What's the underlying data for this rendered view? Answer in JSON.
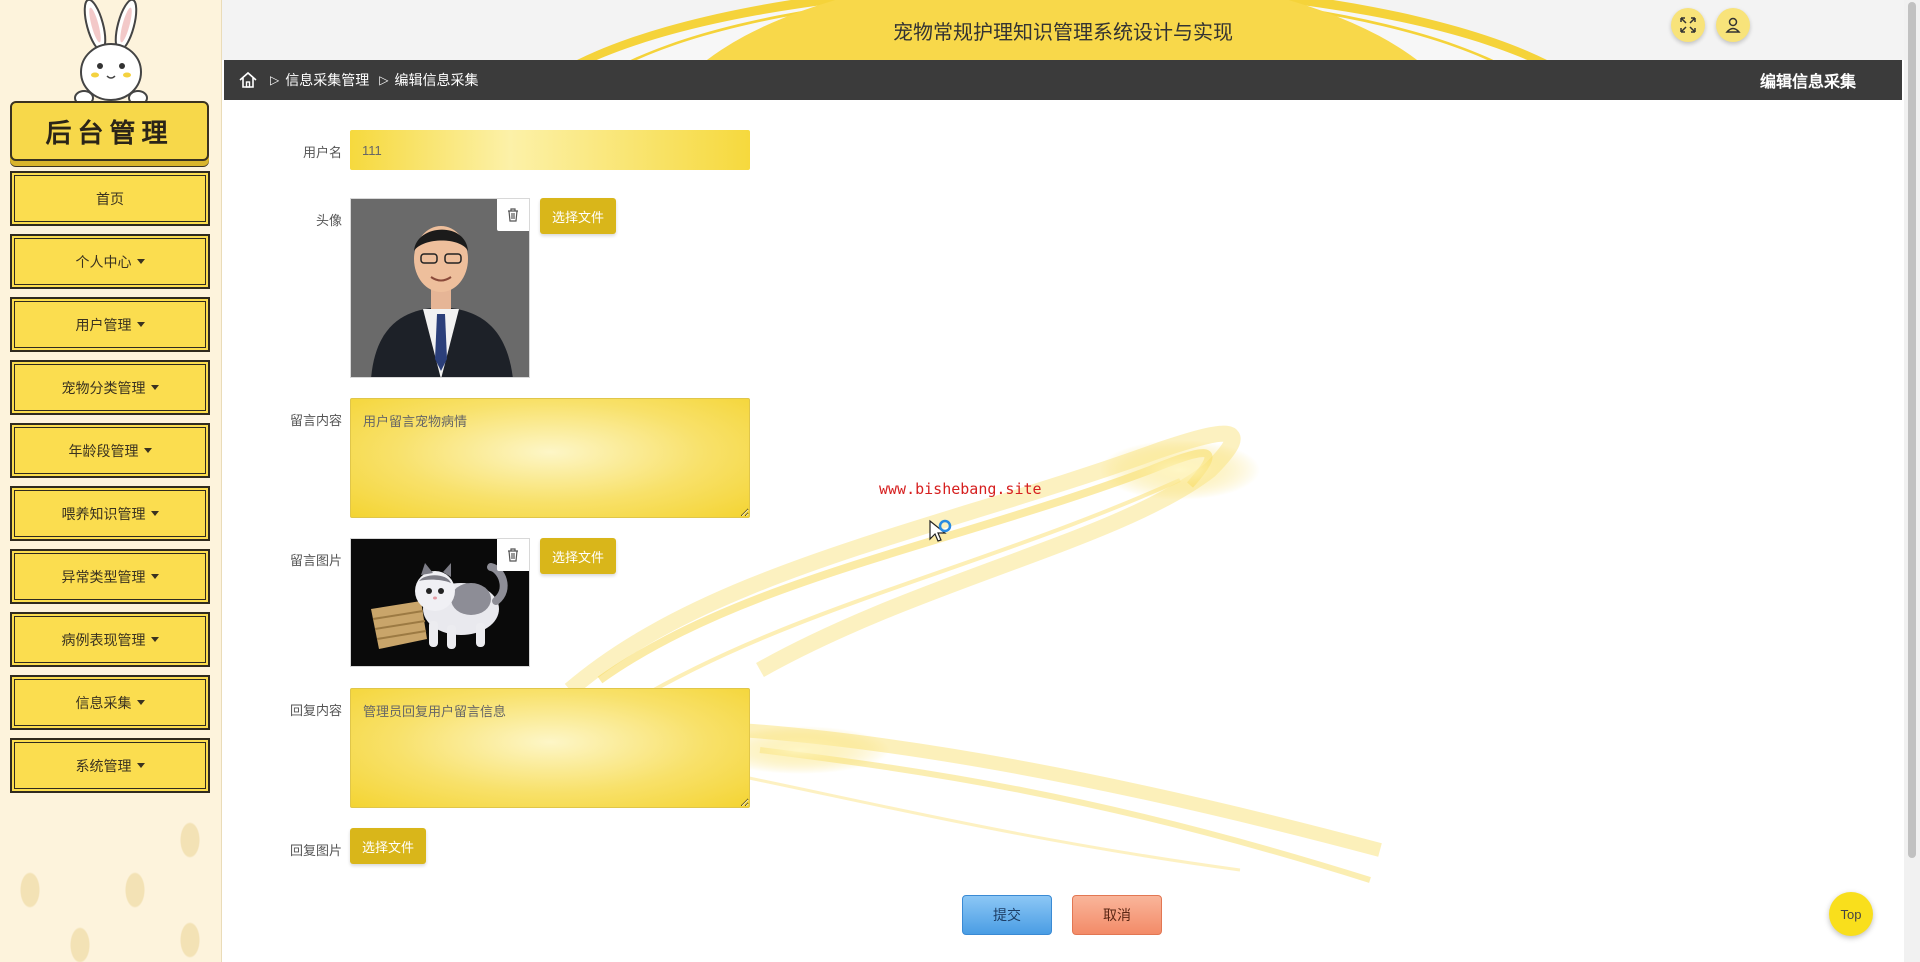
{
  "sidebar": {
    "brand_title": "后台管理",
    "items": [
      {
        "label": "首页",
        "has_caret": false
      },
      {
        "label": "个人中心",
        "has_caret": true
      },
      {
        "label": "用户管理",
        "has_caret": true
      },
      {
        "label": "宠物分类管理",
        "has_caret": true
      },
      {
        "label": "年龄段管理",
        "has_caret": true
      },
      {
        "label": "喂养知识管理",
        "has_caret": true
      },
      {
        "label": "异常类型管理",
        "has_caret": true
      },
      {
        "label": "病例表现管理",
        "has_caret": true
      },
      {
        "label": "信息采集",
        "has_caret": true
      },
      {
        "label": "系统管理",
        "has_caret": true
      }
    ]
  },
  "header": {
    "title": "宠物常规护理知识管理系统设计与实现",
    "fullscreen_icon": "fullscreen-icon",
    "user_icon": "user-icon"
  },
  "breadcrumb": {
    "home_icon": "home-icon",
    "items": [
      "信息采集管理",
      "编辑信息采集"
    ],
    "current_page_title": "编辑信息采集"
  },
  "form": {
    "username": {
      "label": "用户名",
      "value": "111"
    },
    "avatar": {
      "label": "头像",
      "upload_label": "选择文件"
    },
    "message": {
      "label": "留言内容",
      "value": "用户留言宠物病情"
    },
    "message_image": {
      "label": "留言图片",
      "upload_label": "选择文件"
    },
    "reply": {
      "label": "回复内容",
      "value": "管理员回复用户留言信息"
    },
    "reply_image": {
      "label": "回复图片",
      "upload_label": "选择文件"
    },
    "submit_label": "提交",
    "cancel_label": "取消"
  },
  "watermark": "www.bishebang.site",
  "back_to_top_label": "Top",
  "colors": {
    "accent_yellow": "#fbdd4f",
    "crumb_bar": "#3b3b3b",
    "submit_blue": "#4a9de4",
    "cancel_orange": "#f38b68"
  }
}
